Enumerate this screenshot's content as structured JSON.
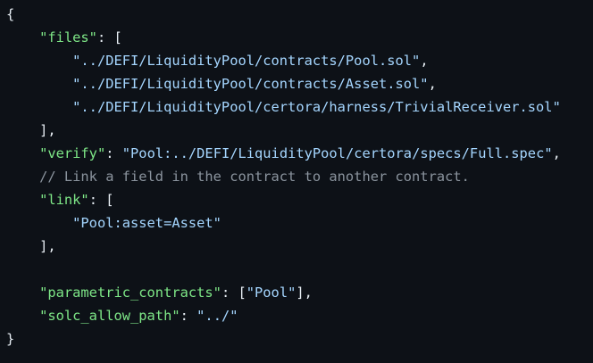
{
  "lines": [
    {
      "segments": [
        {
          "t": "punct",
          "text": "{"
        }
      ]
    },
    {
      "segments": [
        {
          "t": "punct",
          "text": "    "
        },
        {
          "t": "key",
          "text": "\"files\""
        },
        {
          "t": "punct",
          "text": ": ["
        }
      ]
    },
    {
      "segments": [
        {
          "t": "punct",
          "text": "        "
        },
        {
          "t": "str",
          "text": "\"../DEFI/LiquidityPool/contracts/Pool.sol\""
        },
        {
          "t": "punct",
          "text": ","
        }
      ]
    },
    {
      "segments": [
        {
          "t": "punct",
          "text": "        "
        },
        {
          "t": "str",
          "text": "\"../DEFI/LiquidityPool/contracts/Asset.sol\""
        },
        {
          "t": "punct",
          "text": ","
        }
      ]
    },
    {
      "segments": [
        {
          "t": "punct",
          "text": "        "
        },
        {
          "t": "str",
          "text": "\"../DEFI/LiquidityPool/certora/harness/TrivialReceiver.sol\""
        }
      ]
    },
    {
      "segments": [
        {
          "t": "punct",
          "text": "    ],"
        }
      ]
    },
    {
      "segments": [
        {
          "t": "punct",
          "text": "    "
        },
        {
          "t": "key",
          "text": "\"verify\""
        },
        {
          "t": "punct",
          "text": ": "
        },
        {
          "t": "str",
          "text": "\"Pool:../DEFI/LiquidityPool/certora/specs/Full.spec\""
        },
        {
          "t": "punct",
          "text": ","
        }
      ]
    },
    {
      "segments": [
        {
          "t": "punct",
          "text": "    "
        },
        {
          "t": "comment",
          "text": "// Link a field in the contract to another contract."
        }
      ]
    },
    {
      "segments": [
        {
          "t": "punct",
          "text": "    "
        },
        {
          "t": "key",
          "text": "\"link\""
        },
        {
          "t": "punct",
          "text": ": ["
        }
      ]
    },
    {
      "segments": [
        {
          "t": "punct",
          "text": "        "
        },
        {
          "t": "str",
          "text": "\"Pool:asset=Asset\""
        }
      ]
    },
    {
      "segments": [
        {
          "t": "punct",
          "text": "    ],"
        }
      ]
    },
    {
      "segments": [
        {
          "t": "punct",
          "text": ""
        }
      ]
    },
    {
      "segments": [
        {
          "t": "punct",
          "text": "    "
        },
        {
          "t": "key",
          "text": "\"parametric_contracts\""
        },
        {
          "t": "punct",
          "text": ": ["
        },
        {
          "t": "str",
          "text": "\"Pool\""
        },
        {
          "t": "punct",
          "text": "],"
        }
      ]
    },
    {
      "segments": [
        {
          "t": "punct",
          "text": "    "
        },
        {
          "t": "key",
          "text": "\"solc_allow_path\""
        },
        {
          "t": "punct",
          "text": ": "
        },
        {
          "t": "str",
          "text": "\"../\""
        }
      ]
    },
    {
      "segments": [
        {
          "t": "punct",
          "text": "}"
        }
      ]
    }
  ],
  "colors": {
    "background": "#0d1117",
    "punctuation": "#e6edf3",
    "key": "#7ee787",
    "string": "#a5d6ff",
    "comment": "#8b949e"
  }
}
